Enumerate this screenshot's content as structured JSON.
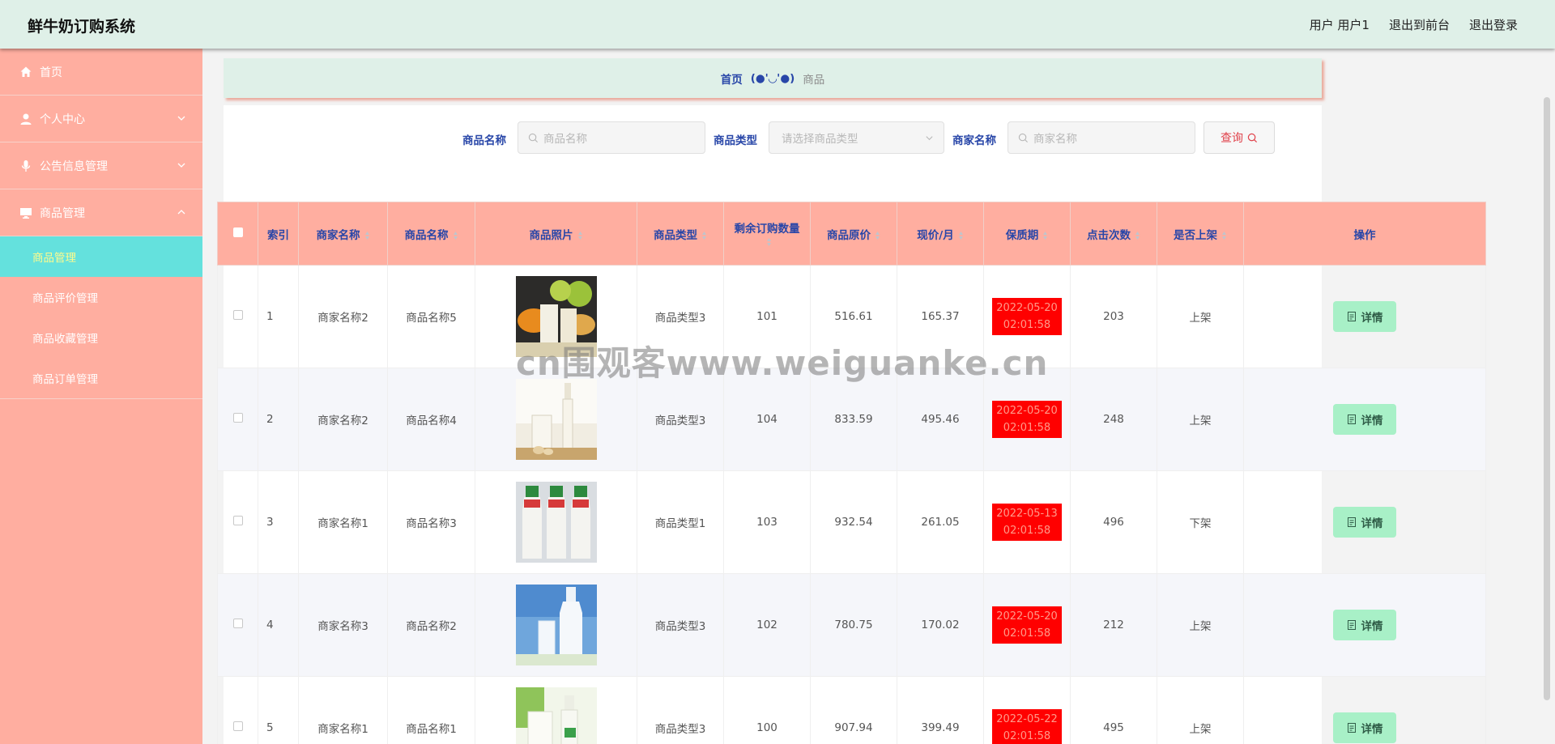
{
  "header": {
    "title": "鲜牛奶订购系统",
    "user": "用户 用户1",
    "to_front": "退出到前台",
    "logout": "退出登录"
  },
  "sidebar": {
    "items": [
      {
        "label": "首页",
        "icon": "home-icon"
      },
      {
        "label": "个人中心",
        "icon": "user-icon"
      },
      {
        "label": "公告信息管理",
        "icon": "microphone-icon"
      },
      {
        "label": "商品管理",
        "icon": "monitor-icon"
      }
    ],
    "sub_items": [
      {
        "label": "商品管理",
        "active": true
      },
      {
        "label": "商品评价管理"
      },
      {
        "label": "商品收藏管理"
      },
      {
        "label": "商品订单管理"
      }
    ]
  },
  "breadcrumb": {
    "home": "首页",
    "face": "(●'◡'●)",
    "current": "商品"
  },
  "search": {
    "name_label": "商品名称",
    "name_placeholder": "商品名称",
    "type_label": "商品类型",
    "type_placeholder": "请选择商品类型",
    "shop_label": "商家名称",
    "shop_placeholder": "商家名称",
    "query_label": "查询"
  },
  "table": {
    "columns": [
      "索引",
      "商家名称",
      "商品名称",
      "商品照片",
      "商品类型",
      "剩余订购数量",
      "商品原价",
      "现价/月",
      "保质期",
      "点击次数",
      "是否上架",
      "操作"
    ],
    "detail_label": "详情",
    "rows": [
      {
        "index": "1",
        "shop": "商家名称2",
        "name": "商品名称5",
        "type": "商品类型3",
        "stock": "101",
        "price": "516.61",
        "now": "165.37",
        "expire": "2022-05-20 02:01:58",
        "clicks": "203",
        "status": "上架"
      },
      {
        "index": "2",
        "shop": "商家名称2",
        "name": "商品名称4",
        "type": "商品类型3",
        "stock": "104",
        "price": "833.59",
        "now": "495.46",
        "expire": "2022-05-20 02:01:58",
        "clicks": "248",
        "status": "上架"
      },
      {
        "index": "3",
        "shop": "商家名称1",
        "name": "商品名称3",
        "type": "商品类型1",
        "stock": "103",
        "price": "932.54",
        "now": "261.05",
        "expire": "2022-05-13 02:01:58",
        "clicks": "496",
        "status": "下架"
      },
      {
        "index": "4",
        "shop": "商家名称3",
        "name": "商品名称2",
        "type": "商品类型3",
        "stock": "102",
        "price": "780.75",
        "now": "170.02",
        "expire": "2022-05-20 02:01:58",
        "clicks": "212",
        "status": "上架"
      },
      {
        "index": "5",
        "shop": "商家名称1",
        "name": "商品名称1",
        "type": "商品类型3",
        "stock": "100",
        "price": "907.94",
        "now": "399.49",
        "expire": "2022-05-22 02:01:58",
        "clicks": "495",
        "status": "上架"
      }
    ]
  },
  "watermark": "cn围观客www.weiguanke.cn",
  "colors": {
    "header_bg": "#dff0e8",
    "sidebar_bg": "#ffaea0",
    "active_sub": "#64e1dd",
    "accent_text": "#2846a8",
    "expire_bg": "#ff0000",
    "detail_btn": "#a8f0c7"
  }
}
